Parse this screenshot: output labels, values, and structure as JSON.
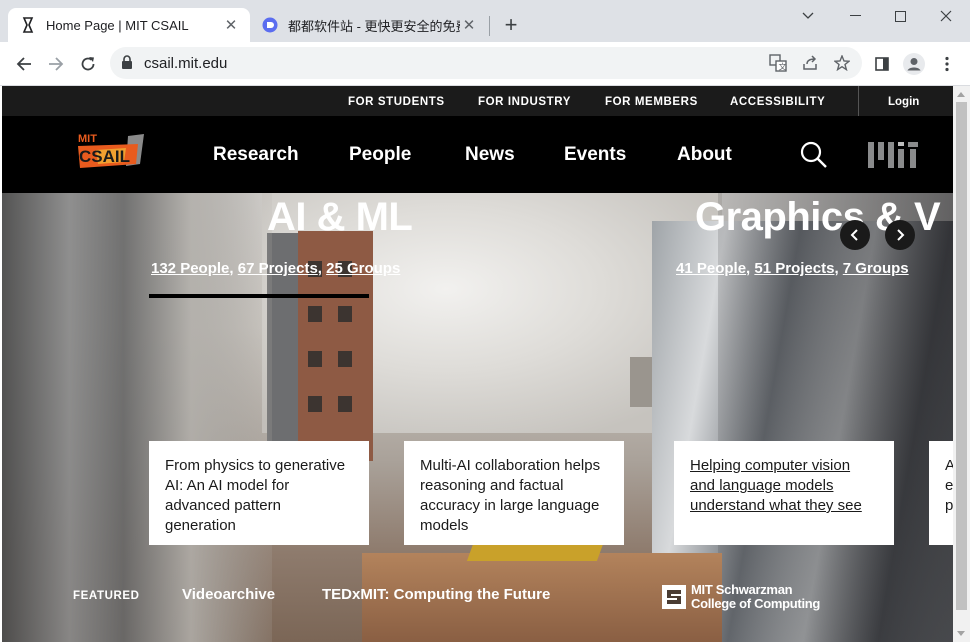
{
  "browser": {
    "tabs": [
      {
        "title": "Home Page | MIT CSAIL",
        "active": true,
        "favicon": "csail-pen-icon"
      },
      {
        "title": "都都软件站 - 更快更安全的免费",
        "active": false,
        "favicon": "blue-circle-icon"
      }
    ],
    "address": "csail.mit.edu"
  },
  "utility_nav": {
    "links": [
      "FOR STUDENTS",
      "FOR INDUSTRY",
      "FOR MEMBERS",
      "ACCESSIBILITY"
    ],
    "login": "Login"
  },
  "logo": {
    "top_text": "MIT",
    "main_text": "CSAIL"
  },
  "main_nav": [
    "Research",
    "People",
    "News",
    "Events",
    "About"
  ],
  "hero": {
    "slides": [
      {
        "title": "AI & ML",
        "people": "132 People",
        "projects": "67 Projects",
        "groups": "25 Groups"
      },
      {
        "title": "Graphics & V",
        "people": "41 People",
        "projects": "51 Projects",
        "groups": "7 Groups"
      }
    ]
  },
  "cards": [
    {
      "text": "From physics to generative AI: An AI model for advanced pattern generation"
    },
    {
      "text": "Multi-AI collaboration helps reasoning and factual accuracy in large language models"
    },
    {
      "text": "Helping computer vision and language models understand what they see"
    },
    {
      "text": "A e p"
    }
  ],
  "featured": {
    "label": "FEATURED",
    "links": [
      "Videoarchive",
      "TEDxMIT: Computing the Future"
    ]
  },
  "schwarzman": {
    "line1": "MIT Schwarzman",
    "line2": "College of Computing"
  },
  "colors": {
    "accent_orange": "#e85b1e",
    "nav_bg": "#000000",
    "utility_bg": "#1b1b1b"
  }
}
